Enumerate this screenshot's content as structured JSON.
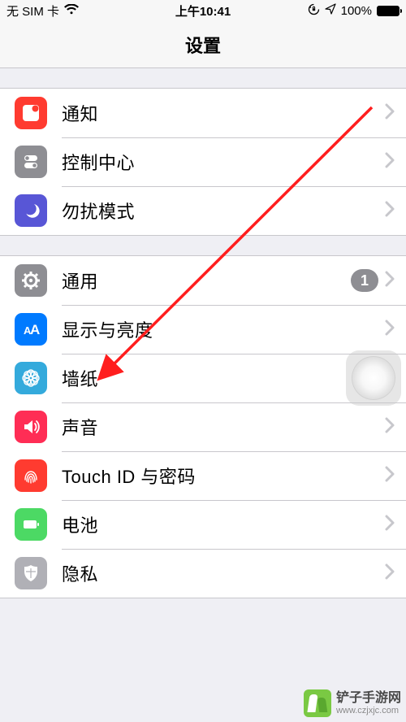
{
  "status_bar": {
    "carrier": "无 SIM 卡",
    "time": "上午10:41",
    "battery_pct": "100%"
  },
  "header": {
    "title": "设置"
  },
  "group1": {
    "notifications": "通知",
    "control_center": "控制中心",
    "dnd": "勿扰模式"
  },
  "group2": {
    "general": "通用",
    "general_badge": "1",
    "display": "显示与亮度",
    "wallpaper": "墙纸",
    "sound": "声音",
    "touchid": "Touch ID 与密码",
    "battery": "电池",
    "privacy": "隐私"
  },
  "watermark": {
    "name": "铲子手游网",
    "url": "www.czjxjc.com"
  },
  "arrow": {
    "color": "#ff1e1e"
  }
}
